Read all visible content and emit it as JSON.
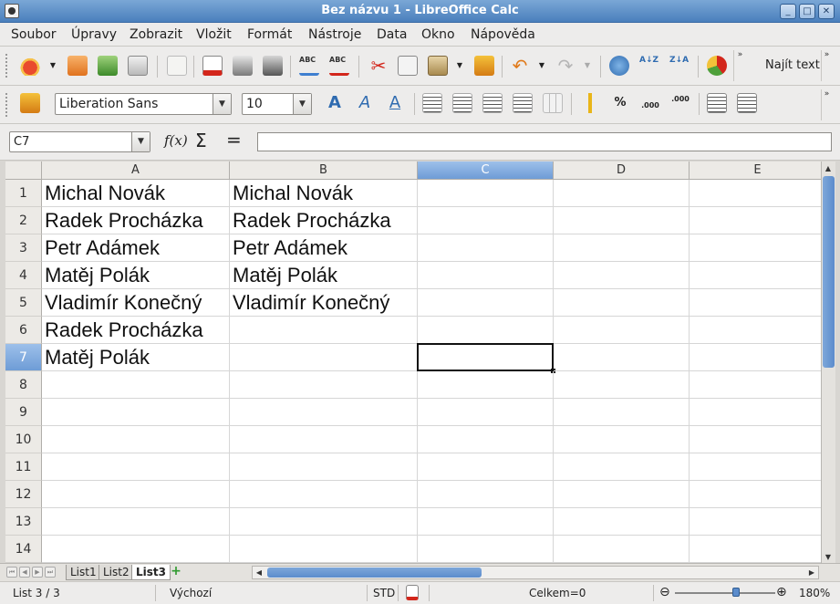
{
  "window": {
    "title": "Bez názvu 1 - LibreOffice Calc",
    "buttons": [
      "_",
      "□",
      "✕"
    ]
  },
  "menu": [
    "Soubor",
    "Úpravy",
    "Zobrazit",
    "Vložit",
    "Formát",
    "Nástroje",
    "Data",
    "Okno",
    "Nápověda"
  ],
  "toolbar": {
    "find_text": "Najít text",
    "overflow": "»"
  },
  "format": {
    "font_name": "Liberation Sans",
    "font_size": "10",
    "percent": "%",
    "dec_add": ".000",
    "dec_del": ".000"
  },
  "formula": {
    "name_box": "C7",
    "value": ""
  },
  "colors": {
    "accent": "#5b8ccc",
    "selection": "#9dc0ea"
  },
  "columns": [
    "A",
    "B",
    "C",
    "D",
    "E"
  ],
  "rows": [
    "1",
    "2",
    "3",
    "4",
    "5",
    "6",
    "7",
    "8",
    "9",
    "10",
    "11",
    "12",
    "13",
    "14"
  ],
  "cells": {
    "A": [
      "Michal Novák",
      "Radek Procházka",
      "Petr Adámek",
      "Matěj Polák",
      "Vladimír Konečný",
      "Radek Procházka",
      "Matěj Polák"
    ],
    "B": [
      "Michal Novák",
      "Radek Procházka",
      "Petr Adámek",
      "Matěj Polák",
      "Vladimír Konečný"
    ]
  },
  "active_cell": "C7",
  "sheets": [
    "List1",
    "List2",
    "List3"
  ],
  "active_sheet": "List3",
  "status": {
    "sheet": "List 3 / 3",
    "style": "Výchozí",
    "mode": "STD",
    "sum": "Celkem=0",
    "zoom": "180%",
    "zoom_minus": "⊖",
    "zoom_plus": "⊕"
  }
}
